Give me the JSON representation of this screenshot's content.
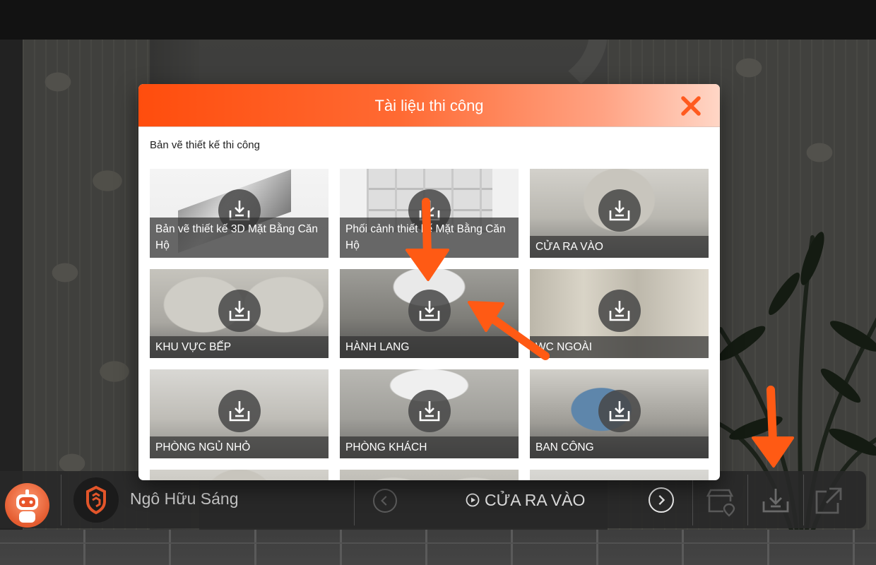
{
  "modal": {
    "title": "Tài liệu thi công",
    "section_title": "Bản vẽ thiết kế thi công",
    "items": [
      {
        "label": "Bản vẽ thiết kế 3D Mặt Bằng Căn Hộ",
        "thumb": "t-iso"
      },
      {
        "label": "Phối cảnh thiết kế Mặt Bằng Căn Hộ",
        "thumb": "t-plan"
      },
      {
        "label": "CỬA RA VÀO",
        "thumb": "t-pano"
      },
      {
        "label": "KHU VỰC BẾP",
        "thumb": "t-pano2"
      },
      {
        "label": "HÀNH LANG",
        "thumb": "t-hall"
      },
      {
        "label": "WC NGOÀI",
        "thumb": "t-wc"
      },
      {
        "label": "PHÒNG NGỦ NHỎ",
        "thumb": "t-bed"
      },
      {
        "label": "PHÒNG KHÁCH",
        "thumb": "t-living"
      },
      {
        "label": "BAN CÔNG",
        "thumb": "t-balcony"
      }
    ]
  },
  "bottombar": {
    "user_name": "Ngô Hữu Sáng",
    "current_scene": "CỬA RA VÀO"
  },
  "colors": {
    "accent": "#ff5a1f",
    "arrow": "#ff5a14",
    "bar": "#282828"
  },
  "icons": {
    "close": "close-x-icon",
    "download": "download-tray-icon",
    "scene": "play-circle-icon",
    "store": "store-location-icon",
    "share": "external-link-icon"
  }
}
